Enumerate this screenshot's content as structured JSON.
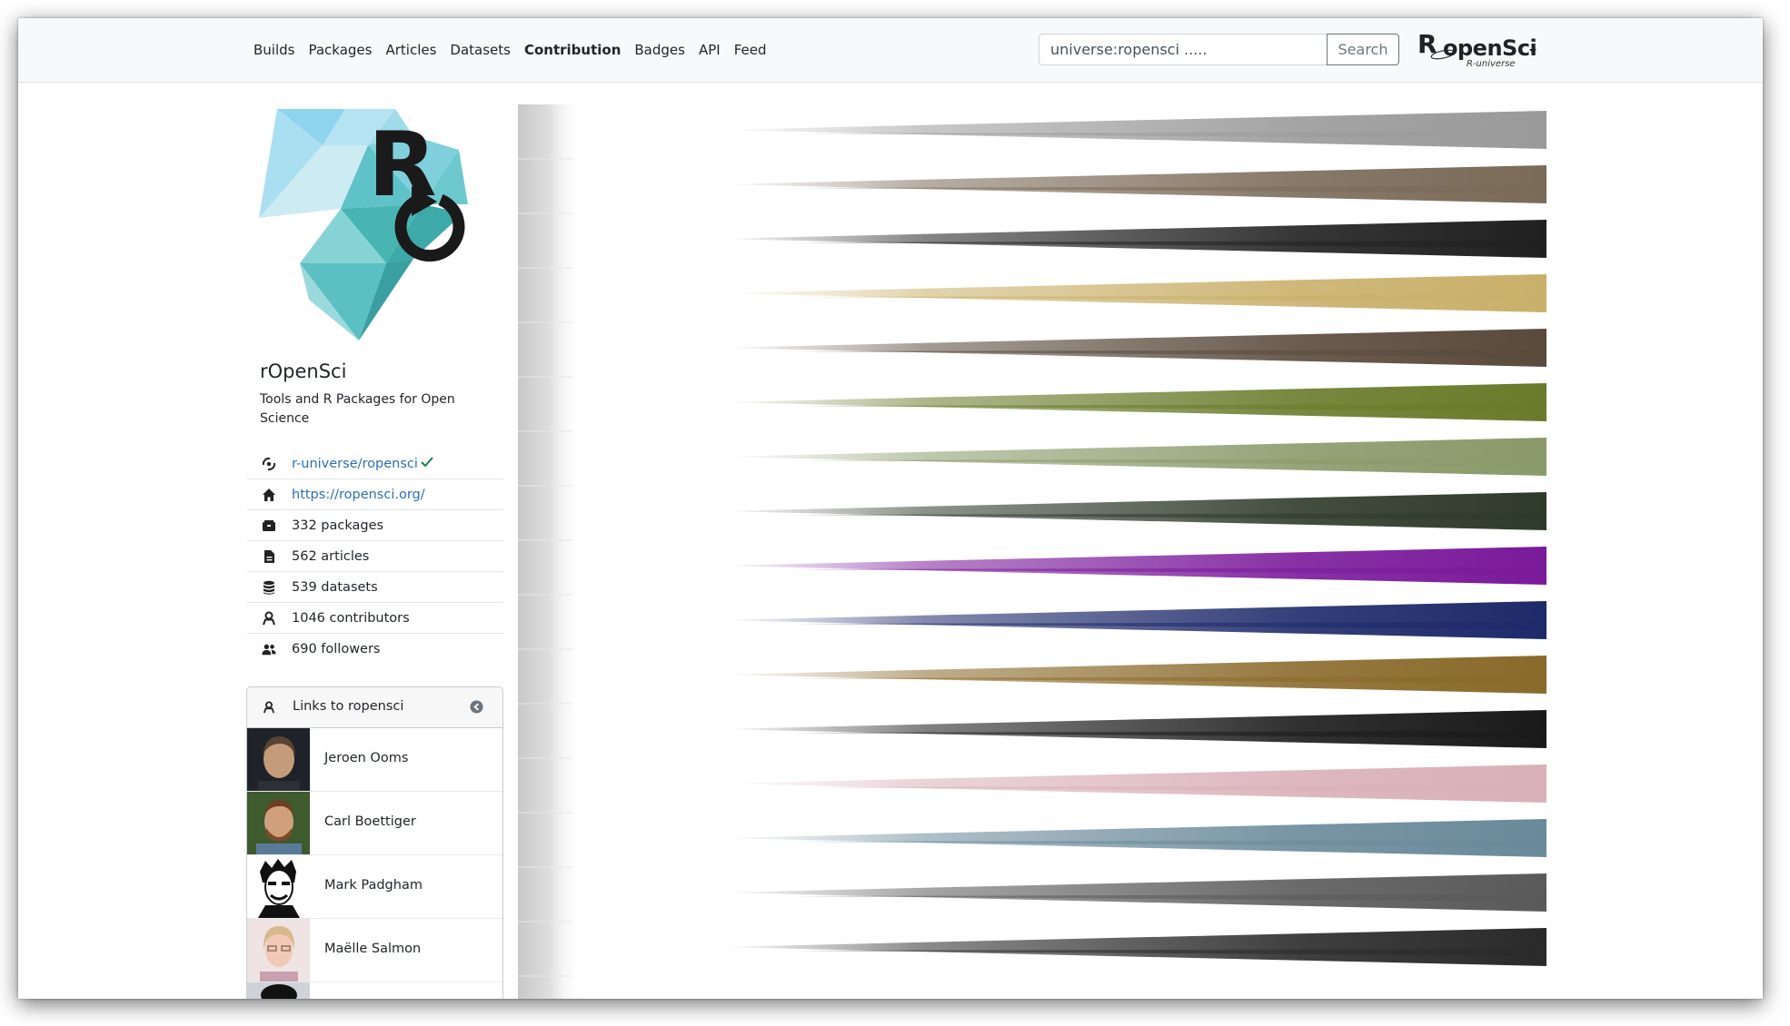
{
  "nav": {
    "links": [
      "Builds",
      "Packages",
      "Articles",
      "Datasets",
      "Contribution",
      "Badges",
      "API",
      "Feed"
    ],
    "active": "Contribution"
  },
  "search": {
    "placeholder": "universe:ropensci .....",
    "button": "Search"
  },
  "brand": {
    "name": "ropenSci",
    "subtitle": "R-universe",
    "icon": "caret-down-icon"
  },
  "org": {
    "name": "rOpenSci",
    "description": "Tools and R Packages for Open Science",
    "info": [
      {
        "icon": "universe-icon",
        "text": "r-universe/ropensci",
        "link": true,
        "verified": true
      },
      {
        "icon": "home-icon",
        "text": "https://ropensci.org/",
        "link": true
      },
      {
        "icon": "packages-icon",
        "text": "332 packages"
      },
      {
        "icon": "file-icon",
        "text": "562 articles"
      },
      {
        "icon": "database-icon",
        "text": "539 datasets"
      },
      {
        "icon": "contributor-icon",
        "text": "1046 contributors"
      },
      {
        "icon": "followers-icon",
        "text": "690 followers"
      }
    ]
  },
  "links_card": {
    "title": "Links to ropensci",
    "contributors": [
      "Jeroen Ooms",
      "Carl Boettiger",
      "Mark Padgham",
      "Maëlle Salmon"
    ]
  },
  "colors": {
    "link": "#2a6ebb",
    "logo_teal": "#7fd3d6",
    "logo_blue": "#a9dff0",
    "chart_bands": [
      "#9a9a9a",
      "#7a6a58",
      "#202020",
      "#c9b06a",
      "#5a4a3c",
      "#6b7a2a",
      "#8a9a6a",
      "#2e3a2a",
      "#7a1a9a",
      "#1e2a6a",
      "#8a6a2a",
      "#1a1a1a",
      "#d9b0b8",
      "#6a8a9a",
      "#5a5a5a",
      "#2a2a2a"
    ]
  }
}
